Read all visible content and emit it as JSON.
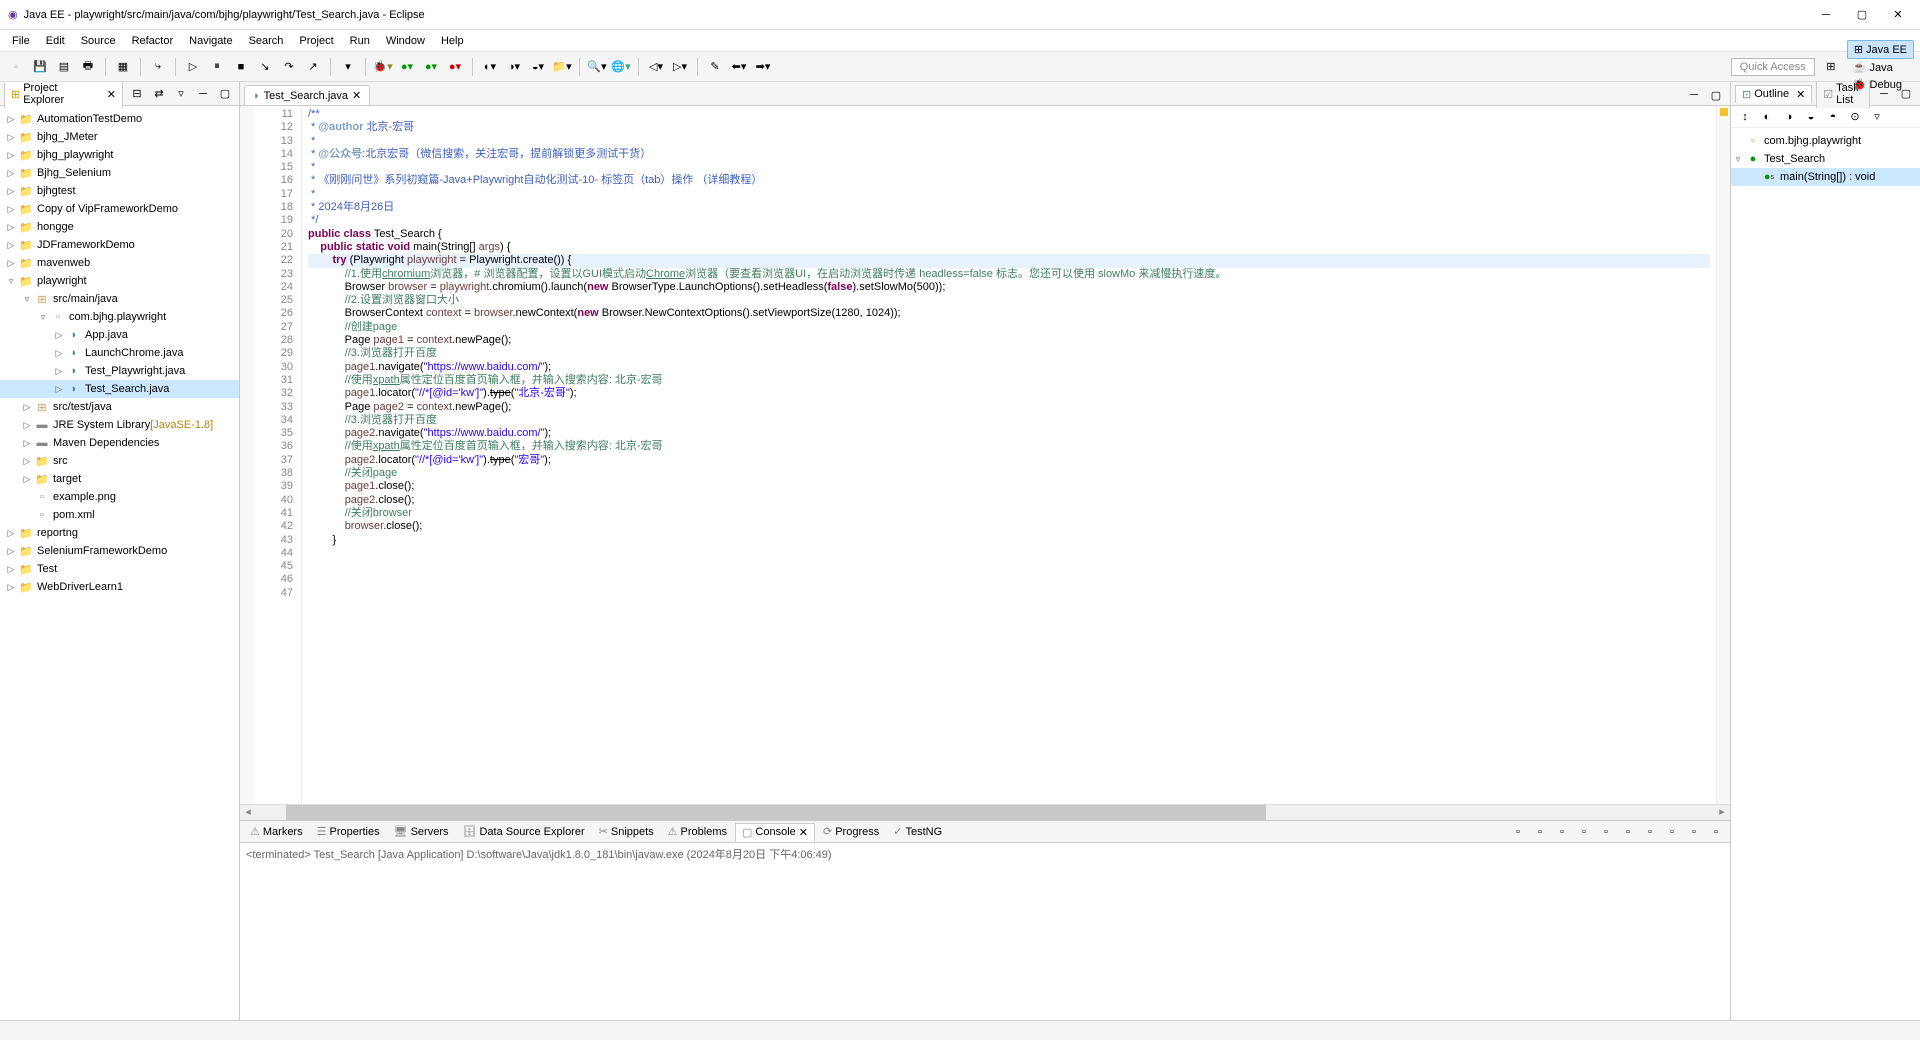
{
  "title": "Java EE - playwright/src/main/java/com/bjhg/playwright/Test_Search.java - Eclipse",
  "menu": [
    "File",
    "Edit",
    "Source",
    "Refactor",
    "Navigate",
    "Search",
    "Project",
    "Run",
    "Window",
    "Help"
  ],
  "quickAccess": "Quick Access",
  "perspectives": [
    {
      "label": "Java EE",
      "active": true
    },
    {
      "label": "Java",
      "active": false
    },
    {
      "label": "Debug",
      "active": false
    }
  ],
  "projectExplorer": {
    "title": "Project Explorer",
    "items": [
      {
        "indent": 0,
        "arrow": "▷",
        "icon": "folder",
        "label": "AutomationTestDemo"
      },
      {
        "indent": 0,
        "arrow": "▷",
        "icon": "folder",
        "label": "bjhg_JMeter"
      },
      {
        "indent": 0,
        "arrow": "▷",
        "icon": "folder",
        "label": "bjhg_playwright"
      },
      {
        "indent": 0,
        "arrow": "▷",
        "icon": "folder",
        "label": "Bjhg_Selenium"
      },
      {
        "indent": 0,
        "arrow": "▷",
        "icon": "folder",
        "label": "bjhgtest"
      },
      {
        "indent": 0,
        "arrow": "▷",
        "icon": "folder",
        "label": "Copy of VipFrameworkDemo"
      },
      {
        "indent": 0,
        "arrow": "▷",
        "icon": "folder",
        "label": "hongge"
      },
      {
        "indent": 0,
        "arrow": "▷",
        "icon": "folder",
        "label": "JDFrameworkDemo"
      },
      {
        "indent": 0,
        "arrow": "▷",
        "icon": "folder",
        "label": "mavenweb"
      },
      {
        "indent": 0,
        "arrow": "▿",
        "icon": "folder",
        "label": "playwright"
      },
      {
        "indent": 1,
        "arrow": "▿",
        "icon": "pkg-src",
        "label": "src/main/java"
      },
      {
        "indent": 2,
        "arrow": "▿",
        "icon": "pkg",
        "label": "com.bjhg.playwright"
      },
      {
        "indent": 3,
        "arrow": "▷",
        "icon": "java",
        "label": "App.java"
      },
      {
        "indent": 3,
        "arrow": "▷",
        "icon": "java",
        "label": "LaunchChrome.java"
      },
      {
        "indent": 3,
        "arrow": "▷",
        "icon": "java",
        "label": "Test_Playwright.java"
      },
      {
        "indent": 3,
        "arrow": "▷",
        "icon": "java",
        "label": "Test_Search.java",
        "selected": true
      },
      {
        "indent": 1,
        "arrow": "▷",
        "icon": "pkg-src",
        "label": "src/test/java"
      },
      {
        "indent": 1,
        "arrow": "▷",
        "icon": "jar",
        "label": "JRE System Library",
        "suffix": " [JavaSE-1.8]"
      },
      {
        "indent": 1,
        "arrow": "▷",
        "icon": "jar",
        "label": "Maven Dependencies"
      },
      {
        "indent": 1,
        "arrow": "▷",
        "icon": "folder",
        "label": "src"
      },
      {
        "indent": 1,
        "arrow": "▷",
        "icon": "folder",
        "label": "target"
      },
      {
        "indent": 1,
        "arrow": "",
        "icon": "file",
        "label": "example.png"
      },
      {
        "indent": 1,
        "arrow": "",
        "icon": "file",
        "label": "pom.xml"
      },
      {
        "indent": 0,
        "arrow": "▷",
        "icon": "folder",
        "label": "reportng"
      },
      {
        "indent": 0,
        "arrow": "▷",
        "icon": "folder",
        "label": "SeleniumFrameworkDemo"
      },
      {
        "indent": 0,
        "arrow": "▷",
        "icon": "folder",
        "label": "Test"
      },
      {
        "indent": 0,
        "arrow": "▷",
        "icon": "folder",
        "label": "WebDriverLearn1"
      }
    ]
  },
  "editor": {
    "tabLabel": "Test_Search.java",
    "startLine": 11,
    "highlightLine": 23,
    "code": [
      {
        "n": 11,
        "t": "/**",
        "cls": "jd"
      },
      {
        "n": 12,
        "t": " * @author 北京-宏哥",
        "cls": "jd",
        "pre": " * ",
        "tag": "@author",
        "rest": " 北京-宏哥"
      },
      {
        "n": 13,
        "t": " *",
        "cls": "jd"
      },
      {
        "n": 14,
        "t": " * @公众号:北京宏哥（微信搜索，关注宏哥，提前解锁更多测试干货）",
        "cls": "jd",
        "pre": " * ",
        "tag": "@公众号",
        "rest": ":北京宏哥（微信搜索，关注宏哥，提前解锁更多测试干货）"
      },
      {
        "n": 15,
        "t": " *",
        "cls": "jd"
      },
      {
        "n": 16,
        "t": " * 《刚刚问世》系列初窥篇-Java+Playwright自动化测试-10- 标签页（tab）操作 （详细教程）",
        "cls": "jd"
      },
      {
        "n": 17,
        "t": " *",
        "cls": "jd"
      },
      {
        "n": 18,
        "t": " * 2024年8月26日",
        "cls": "jd"
      },
      {
        "n": 19,
        "t": " */",
        "cls": "jd"
      },
      {
        "n": 20,
        "html": "<span class='kw'>public</span> <span class='kw'>class</span> Test_Search {"
      },
      {
        "n": 21,
        "t": ""
      },
      {
        "n": 22,
        "html": "    <span class='kw'>public</span> <span class='kw'>static</span> <span class='kw'>void</span> main(String[] <span class='var'>args</span>) {"
      },
      {
        "n": 23,
        "html": "        <span class='kw'>try</span> (Playwright <span class='var'>playwright</span> = Playwright.create()) {"
      },
      {
        "n": 24,
        "html": "            <span class='cm'>//1.使用<span class='lnk'>chromium</span>浏览器，# 浏览器配置，设置以GUI模式启动<span class='lnk'>Chrome</span>浏览器（要查看浏览器UI，在启动浏览器时传递 headless=false 标志。您还可以使用 slowMo 来减慢执行速度。</span>"
      },
      {
        "n": 25,
        "html": "            Browser <span class='var'>browser</span> = <span class='var'>playwright</span>.chromium().launch(<span class='kw'>new</span> BrowserType.LaunchOptions().setHeadless(<span class='kw'>false</span>).setSlowMo(500));"
      },
      {
        "n": 26,
        "html": "            <span class='cm'>//2.设置浏览器窗口大小</span>"
      },
      {
        "n": 27,
        "html": "            BrowserContext <span class='var'>context</span> = <span class='var'>browser</span>.newContext(<span class='kw'>new</span> Browser.NewContextOptions().setViewportSize(1280, 1024));"
      },
      {
        "n": 28,
        "html": "            <span class='cm'>//创建page</span>"
      },
      {
        "n": 29,
        "html": "            Page <span class='var'>page1</span> = <span class='var'>context</span>.newPage();"
      },
      {
        "n": 30,
        "t": ""
      },
      {
        "n": 31,
        "html": "            <span class='cm'>//3.浏览器打开百度</span>"
      },
      {
        "n": 32,
        "html": "            <span class='var'>page1</span>.navigate(<span class='str'>\"https://www.baidu.com/\"</span>);"
      },
      {
        "n": 33,
        "t": ""
      },
      {
        "n": 34,
        "html": "            <span class='cm'>//使用<span class='lnk'>xpath</span>属性定位百度首页输入框，并输入搜索内容: 北京-宏哥</span>"
      },
      {
        "n": 35,
        "html": "            <span class='var'>page1</span>.locator(<span class='str'>\"//*[@id='kw']\"</span>).<span style='text-decoration:line-through'>type</span>(<span class='str'>\"北京-宏哥\"</span>);"
      },
      {
        "n": 36,
        "t": ""
      },
      {
        "n": 37,
        "html": "            Page <span class='var'>page2</span> = <span class='var'>context</span>.newPage();"
      },
      {
        "n": 38,
        "html": "            <span class='cm'>//3.浏览器打开百度</span>"
      },
      {
        "n": 39,
        "html": "            <span class='var'>page2</span>.navigate(<span class='str'>\"https://www.baidu.com/\"</span>);"
      },
      {
        "n": 40,
        "html": "            <span class='cm'>//使用<span class='lnk'>xpath</span>属性定位百度首页输入框，并输入搜索内容: 北京-宏哥</span>"
      },
      {
        "n": 41,
        "html": "            <span class='var'>page2</span>.locator(<span class='str'>\"//*[@id='kw']\"</span>).<span style='text-decoration:line-through'>type</span>(<span class='str'>\"宏哥\"</span>);"
      },
      {
        "n": 42,
        "html": "            <span class='cm'>//关闭page</span>"
      },
      {
        "n": 43,
        "html": "            <span class='var'>page1</span>.close();"
      },
      {
        "n": 44,
        "html": "            <span class='var'>page2</span>.close();"
      },
      {
        "n": 45,
        "html": "            <span class='cm'>//关闭browser</span>"
      },
      {
        "n": 46,
        "html": "            <span class='var'>browser</span>.close();"
      },
      {
        "n": 47,
        "html": "        }"
      }
    ]
  },
  "bottomTabs": [
    "Markers",
    "Properties",
    "Servers",
    "Data Source Explorer",
    "Snippets",
    "Problems",
    "Console",
    "Progress",
    "TestNG"
  ],
  "activeBottomTab": "Console",
  "consoleStatus": "<terminated> Test_Search [Java Application] D:\\software\\Java\\jdk1.8.0_181\\bin\\javaw.exe (2024年8月20日 下午4:06:49)",
  "outline": {
    "title": "Outline",
    "taskList": "Task List",
    "package": "com.bjhg.playwright",
    "class": "Test_Search",
    "method": "main(String[]) : void"
  }
}
